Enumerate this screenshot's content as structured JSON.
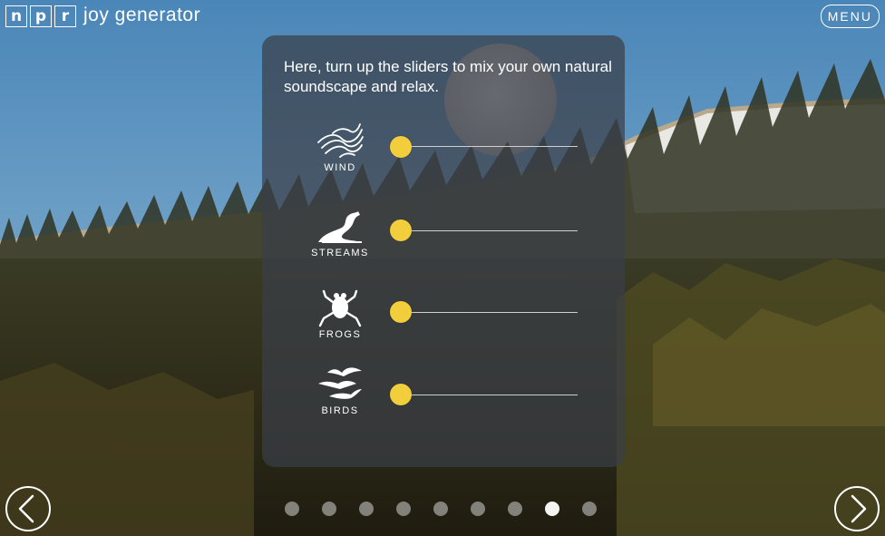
{
  "header": {
    "logo_letters": [
      "n",
      "p",
      "r"
    ],
    "app_title": "joy generator",
    "menu_label": "MENU"
  },
  "panel": {
    "intro": "Here, turn up the sliders to mix your own natural soundscape and relax.",
    "sliders": [
      {
        "label": "WIND",
        "icon": "wind-icon",
        "level": 0
      },
      {
        "label": "STREAMS",
        "icon": "stream-icon",
        "level": 0
      },
      {
        "label": "FROGS",
        "icon": "frog-icon",
        "level": 0
      },
      {
        "label": "BIRDS",
        "icon": "birds-icon",
        "level": 0
      }
    ]
  },
  "pager": {
    "total": 9,
    "active_index": 7
  },
  "nav": {
    "prev_icon": "chevron-left-icon",
    "next_icon": "chevron-right-icon"
  },
  "colors": {
    "slider_knob": "#f2cd3c",
    "panel": "#3a3e46"
  }
}
